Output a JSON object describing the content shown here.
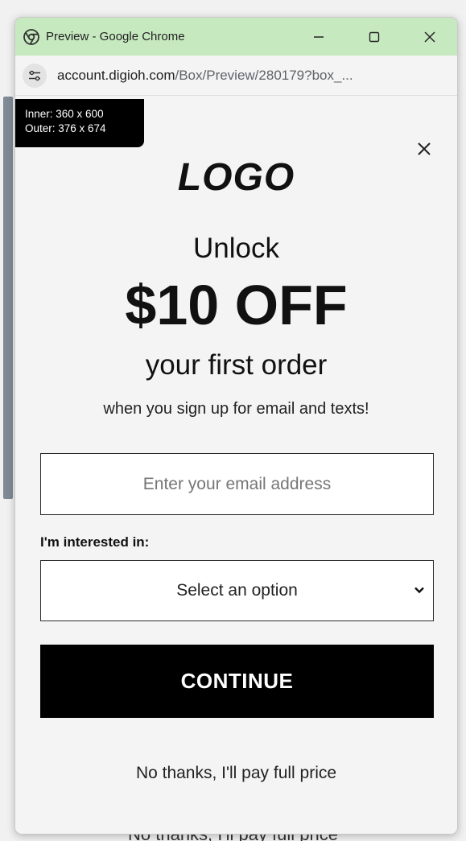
{
  "window": {
    "title": "Preview - Google Chrome",
    "controls": {
      "minimize": "–",
      "maximize": "☐",
      "close": "✕"
    }
  },
  "address_bar": {
    "host": "account.digioh.com",
    "path": "/Box/Preview/280179?box_..."
  },
  "size_badge": {
    "inner": "Inner: 360 x 600",
    "outer": "Outer: 376 x 674"
  },
  "popup": {
    "close_label": "×",
    "logo": "LOGO",
    "unlock": "Unlock",
    "headline": "$10 OFF",
    "subhead": "your first order",
    "tagline": "when you sign up for email and texts!",
    "email_placeholder": "Enter your email address",
    "interest_label": "I'm interested in:",
    "select_value": "Select an option",
    "continue_label": "CONTINUE",
    "no_thanks": "No thanks, I'll pay full price"
  },
  "background_page": {
    "bottom_text": "No thanks, I'll pay full price"
  },
  "colors": {
    "titlebar": "#c7e9c0",
    "popup_bg": "#f4f4f4",
    "button_bg": "#000000",
    "button_text": "#ffffff"
  },
  "icons": {
    "browser_logo": "chrome-icon",
    "site_info": "tune-icon",
    "close": "close-icon",
    "chevron": "chevron-down-icon"
  }
}
